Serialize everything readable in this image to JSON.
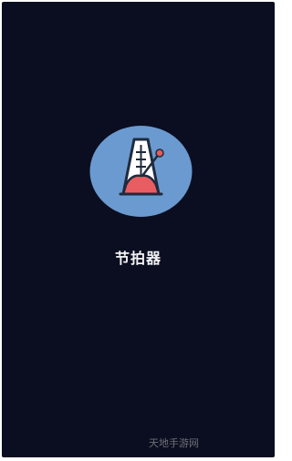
{
  "splash": {
    "app_name": "节拍器",
    "icon": "metronome-icon",
    "background_color": "#0b0e20",
    "icon_circle_color": "#6a9ad0"
  },
  "watermark": {
    "text": "天地手游网"
  }
}
